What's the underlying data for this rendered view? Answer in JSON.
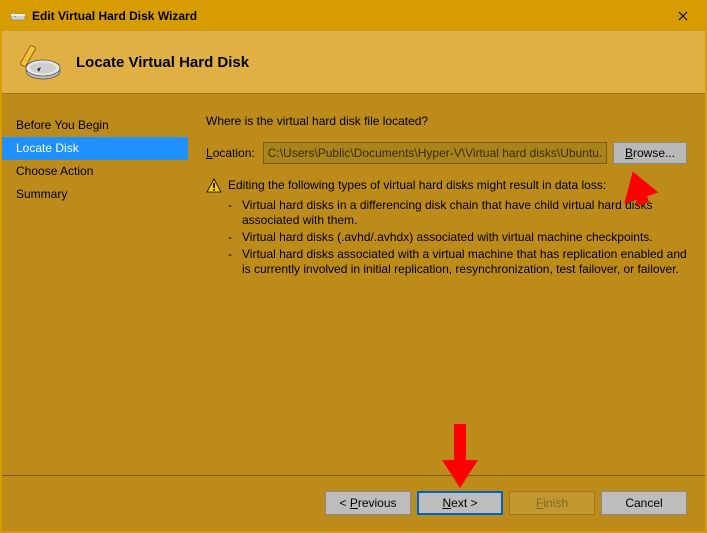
{
  "window": {
    "title": "Edit Virtual Hard Disk Wizard"
  },
  "header": {
    "title": "Locate Virtual Hard Disk"
  },
  "sidebar": {
    "steps": [
      {
        "label": "Before You Begin"
      },
      {
        "label": "Locate Disk"
      },
      {
        "label": "Choose Action"
      },
      {
        "label": "Summary"
      }
    ],
    "active_index": 1
  },
  "main": {
    "question": "Where is the virtual hard disk file located?",
    "location_label": "Location:",
    "location_value": "C:\\Users\\Public\\Documents\\Hyper-V\\Virtual hard disks\\Ubuntu.vhdx",
    "browse_label": "Browse...",
    "warning_text": "Editing the following types of virtual hard disks might result in data loss:",
    "bullets": [
      "Virtual hard disks in a differencing disk chain that have child virtual hard disks associated with them.",
      "Virtual hard disks (.avhd/.avhdx) associated with virtual machine checkpoints.",
      "Virtual hard disks associated with a virtual machine that has replication enabled and is currently involved in initial replication, resynchronization, test failover, or failover."
    ]
  },
  "footer": {
    "previous": "< Previous",
    "next": "Next >",
    "finish": "Finish",
    "cancel": "Cancel"
  }
}
